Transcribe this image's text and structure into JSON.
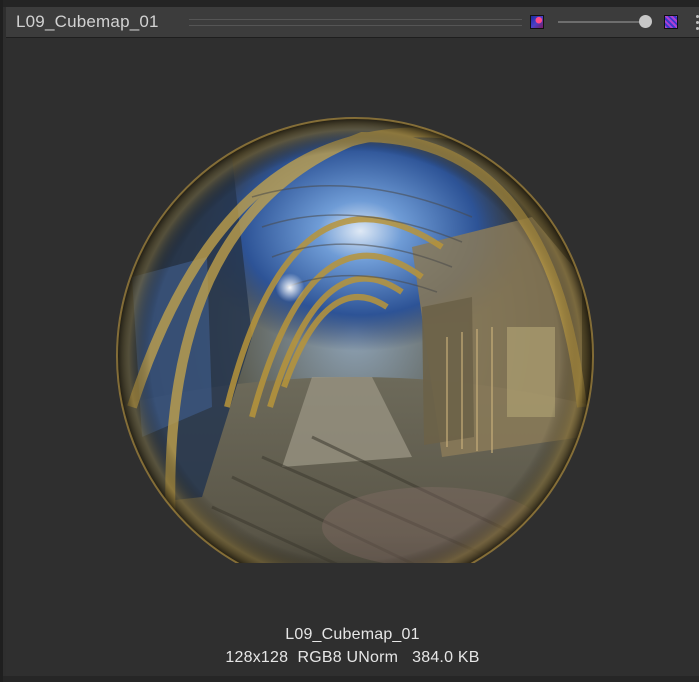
{
  "header": {
    "title": "L09_Cubemap_01",
    "channel_icon": "rgb-channel-icon",
    "alpha_icon": "alpha-checker-icon",
    "menu_icon": "more-vertical-icon",
    "mip_slider_value": 1.0
  },
  "preview": {
    "asset_name": "L09_Cubemap_01",
    "dimensions": "128x128",
    "format": "RGB8 UNorm",
    "size": "384.0 KB"
  },
  "colors": {
    "panel_bg": "#2f2f2f",
    "header_bg": "#3c3c3c",
    "text": "#e6e6e6",
    "sky": "#3a6fb8",
    "brass": "#b8953a"
  }
}
